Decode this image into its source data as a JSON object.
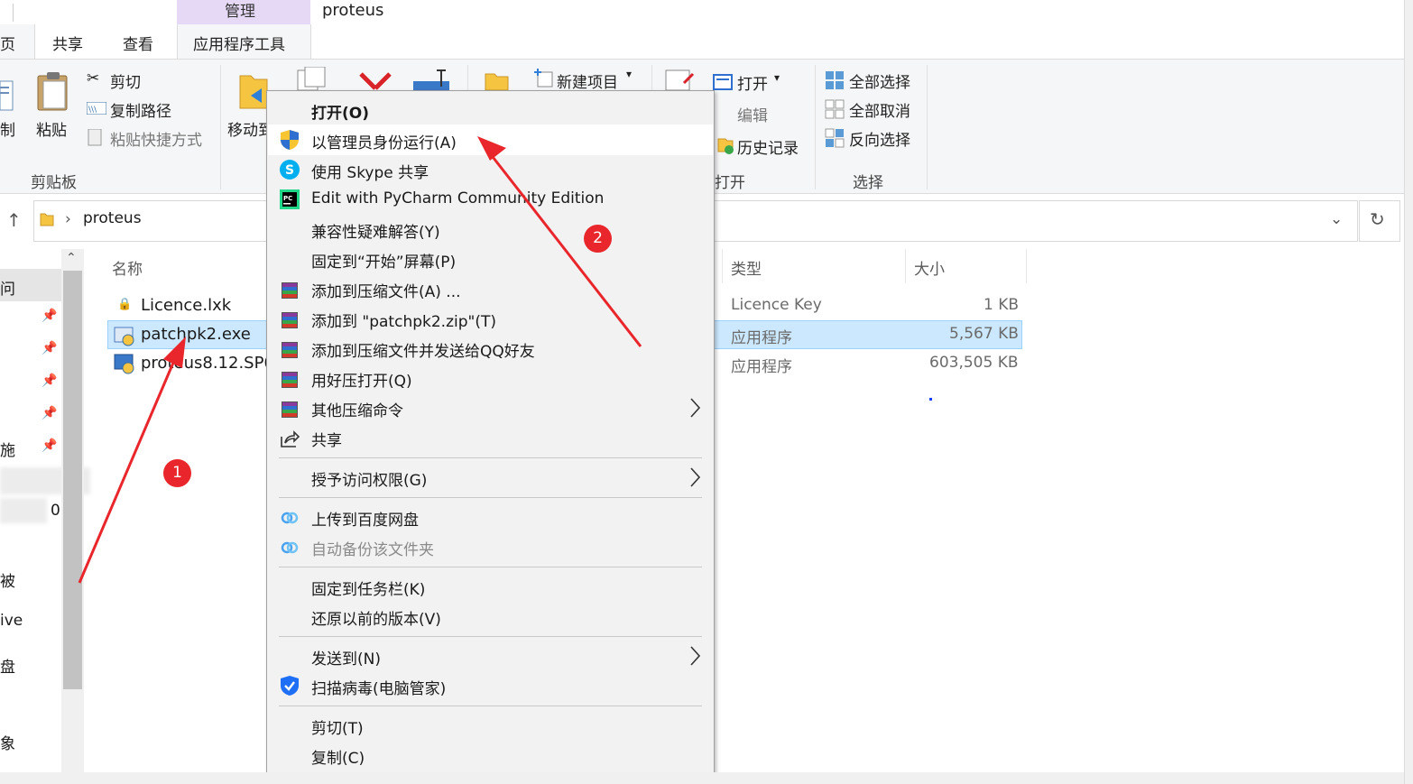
{
  "window": {
    "title": "proteus",
    "context_tab": "管理"
  },
  "tabs": {
    "home_fragment": "页",
    "share": "共享",
    "view": "查看",
    "app_tools": "应用程序工具"
  },
  "ribbon": {
    "copy_fragment": "制",
    "paste": "粘贴",
    "cut": "剪切",
    "copy_path": "复制路径",
    "paste_shortcut": "粘贴快捷方式",
    "clipboard_group": "剪贴板",
    "move_to_fragment": "移动到",
    "new_item": "新建项目",
    "open": "打开",
    "edit": "编辑",
    "history": "历史记录",
    "open_group_fragment": "打开",
    "select_all": "全部选择",
    "select_none": "全部取消",
    "invert_selection": "反向选择",
    "select_group": "选择"
  },
  "address": {
    "folder": "proteus"
  },
  "nav": {
    "items": [
      "问",
      "",
      "",
      "",
      "",
      "施",
      "0",
      "",
      "被",
      "ive",
      "盘",
      "",
      "象"
    ]
  },
  "file_list": {
    "headers": {
      "name": "名称",
      "type": "类型",
      "size": "大小"
    },
    "rows": [
      {
        "name": "Licence.lxk",
        "type": "Licence Key",
        "size": "1 KB"
      },
      {
        "name": "patchpk2.exe",
        "type": "应用程序",
        "size": "5,567 KB"
      },
      {
        "name": "proteus8.12.SP0",
        "type": "应用程序",
        "size": "603,505 KB"
      }
    ]
  },
  "context_menu": {
    "items": [
      "打开(O)",
      "以管理员身份运行(A)",
      "使用 Skype 共享",
      "Edit with PyCharm Community Edition",
      "兼容性疑难解答(Y)",
      "固定到“开始”屏幕(P)",
      "添加到压缩文件(A) ...",
      "添加到 \"patchpk2.zip\"(T)",
      "添加到压缩文件并发送给QQ好友",
      "用好压打开(Q)",
      "其他压缩命令",
      "共享",
      "授予访问权限(G)",
      "上传到百度网盘",
      "自动备份该文件夹",
      "固定到任务栏(K)",
      "还原以前的版本(V)",
      "发送到(N)",
      "扫描病毒(电脑管家)",
      "剪切(T)",
      "复制(C)"
    ]
  },
  "annotations": {
    "badge1": "1",
    "badge2": "2"
  },
  "colors": {
    "selection": "#cce8ff",
    "manage_tab": "#e6d9f5",
    "arrow": "#e8262b"
  }
}
